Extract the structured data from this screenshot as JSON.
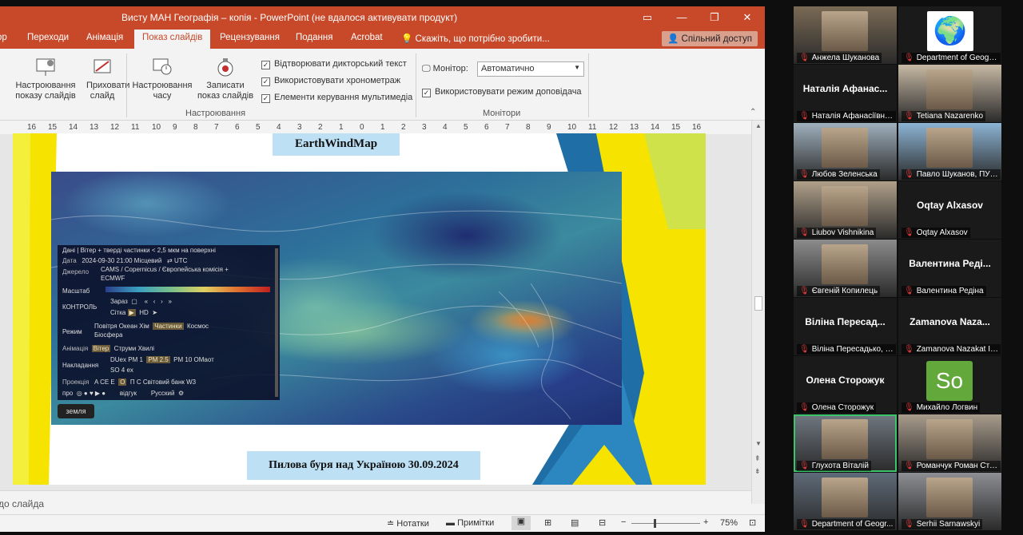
{
  "window": {
    "title": "Висту МАН Географія – копія - PowerPoint (не вдалося активувати продукт)"
  },
  "tabs": [
    {
      "label": "op"
    },
    {
      "label": "Переходи"
    },
    {
      "label": "Анімація"
    },
    {
      "label": "Показ слайдів"
    },
    {
      "label": "Рецензування"
    },
    {
      "label": "Подання"
    },
    {
      "label": "Acrobat"
    }
  ],
  "tellme": "Скажіть, що потрібно зробити...",
  "share": "Спільний доступ",
  "ribbon": {
    "btn_setup": "Настроювання показу слайдів",
    "btn_hide": "Приховати слайд",
    "btn_rehearse": "Настроювання часу",
    "btn_record": "Записати показ слайдів",
    "chk_narration": "Відтворювати дикторський текст",
    "chk_timings": "Використовувати хронометраж",
    "chk_media": "Елементи керування мультимедіа",
    "group_setup": "Настроювання",
    "monitor_label": "Монітор:",
    "monitor_value": "Автоматично",
    "chk_presenter": "Використовувати режим доповідача",
    "group_monitors": "Монітори"
  },
  "ruler": [
    "16",
    "15",
    "14",
    "13",
    "12",
    "11",
    "10",
    "9",
    "8",
    "7",
    "6",
    "5",
    "4",
    "3",
    "2",
    "1",
    "0",
    "1",
    "2",
    "3",
    "4",
    "5",
    "6",
    "7",
    "8",
    "9",
    "10",
    "11",
    "12",
    "13",
    "14",
    "15",
    "16"
  ],
  "slide": {
    "title": "EarthWindMap",
    "caption": "Пилова буря над Україною 30.09.2024"
  },
  "map_panel": {
    "data_row": "Дані | Вітер + тверді частинки < 2,5 мкм на поверхні",
    "date_label": "Дата",
    "date_value": "2024-09-30 21:00 Місцевий",
    "utc": "UTC",
    "source_label": "Джерело",
    "source_value_1": "CAMS / Copernicus / Європейська комісія +",
    "source_value_2": "ECMWF",
    "scale_label": "Масштаб",
    "control_label": "КОНТРОЛЬ",
    "control_now": "Зараз",
    "control_grid": "Сітка",
    "control_hd": "HD",
    "mode_label": "Режим",
    "mode_items": "Повітря  Океан  Хім",
    "mode_active": "Частинки",
    "mode_space": "Космос",
    "mode_bio": "Біосфера",
    "anim_label": "Анімація",
    "anim_active": "Вітер",
    "anim_items": "Струми  Хвилі",
    "overlay_label": "Накладання",
    "overlay_items": "DUex  PM 1",
    "overlay_active": "PM 2.5",
    "overlay_items2": "PM 10  ОМaот",
    "overlay_so4": "SO 4 ex",
    "proj_label": "Проекція",
    "proj_items": "A  CE  E",
    "proj_active": "O",
    "proj_items2": "П  С  Світовий банк  W3",
    "footer_left": "про",
    "footer_mid": "відгук",
    "footer_right": "Русский",
    "earth_btn": "земля"
  },
  "notes_hint": "до слайда",
  "status": {
    "notes": "Нотатки",
    "comments": "Примітки",
    "zoom": "75%"
  },
  "participants": [
    {
      "name": "Анжела Шуканова",
      "type": "video"
    },
    {
      "name": "Department of Geograp...",
      "type": "logo"
    },
    {
      "name": "Наталія Афанасіївна ...",
      "big": "Наталія Афанас...",
      "type": "text"
    },
    {
      "name": "Tetiana Nazarenko",
      "type": "video"
    },
    {
      "name": "Любов Зеленська",
      "type": "video"
    },
    {
      "name": "Павло Шуканов, ПУБ...",
      "type": "video"
    },
    {
      "name": "Liubov Vishnikina",
      "type": "video"
    },
    {
      "name": "Oqtay Alxasov",
      "big": "Oqtay Alxasov",
      "type": "text"
    },
    {
      "name": "Євгеній Копилець",
      "type": "video"
    },
    {
      "name": "Валентина Редіна",
      "big": "Валентина Реді...",
      "type": "text"
    },
    {
      "name": "Віліна Пересадько, К...",
      "big": "Віліна Пересад...",
      "type": "text"
    },
    {
      "name": "Zamanova Nazakat Ib...",
      "big": "Zamanova Naza...",
      "type": "text"
    },
    {
      "name": "Олена Сторожук",
      "big": "Олена Сторожук",
      "type": "text"
    },
    {
      "name": "Михайло Логвин",
      "big": "So",
      "type": "avatar"
    },
    {
      "name": "Глухота Віталій",
      "type": "video",
      "active": true
    },
    {
      "name": "Романчук Роман Ста...",
      "type": "video"
    },
    {
      "name": "Department of Geogr...",
      "type": "video"
    },
    {
      "name": "Serhii Sarnawskyi",
      "type": "video"
    }
  ],
  "colors": {
    "ppt_accent": "#c7492a",
    "active_speaker": "#3cc46a",
    "avatar_green": "#63a83a"
  }
}
